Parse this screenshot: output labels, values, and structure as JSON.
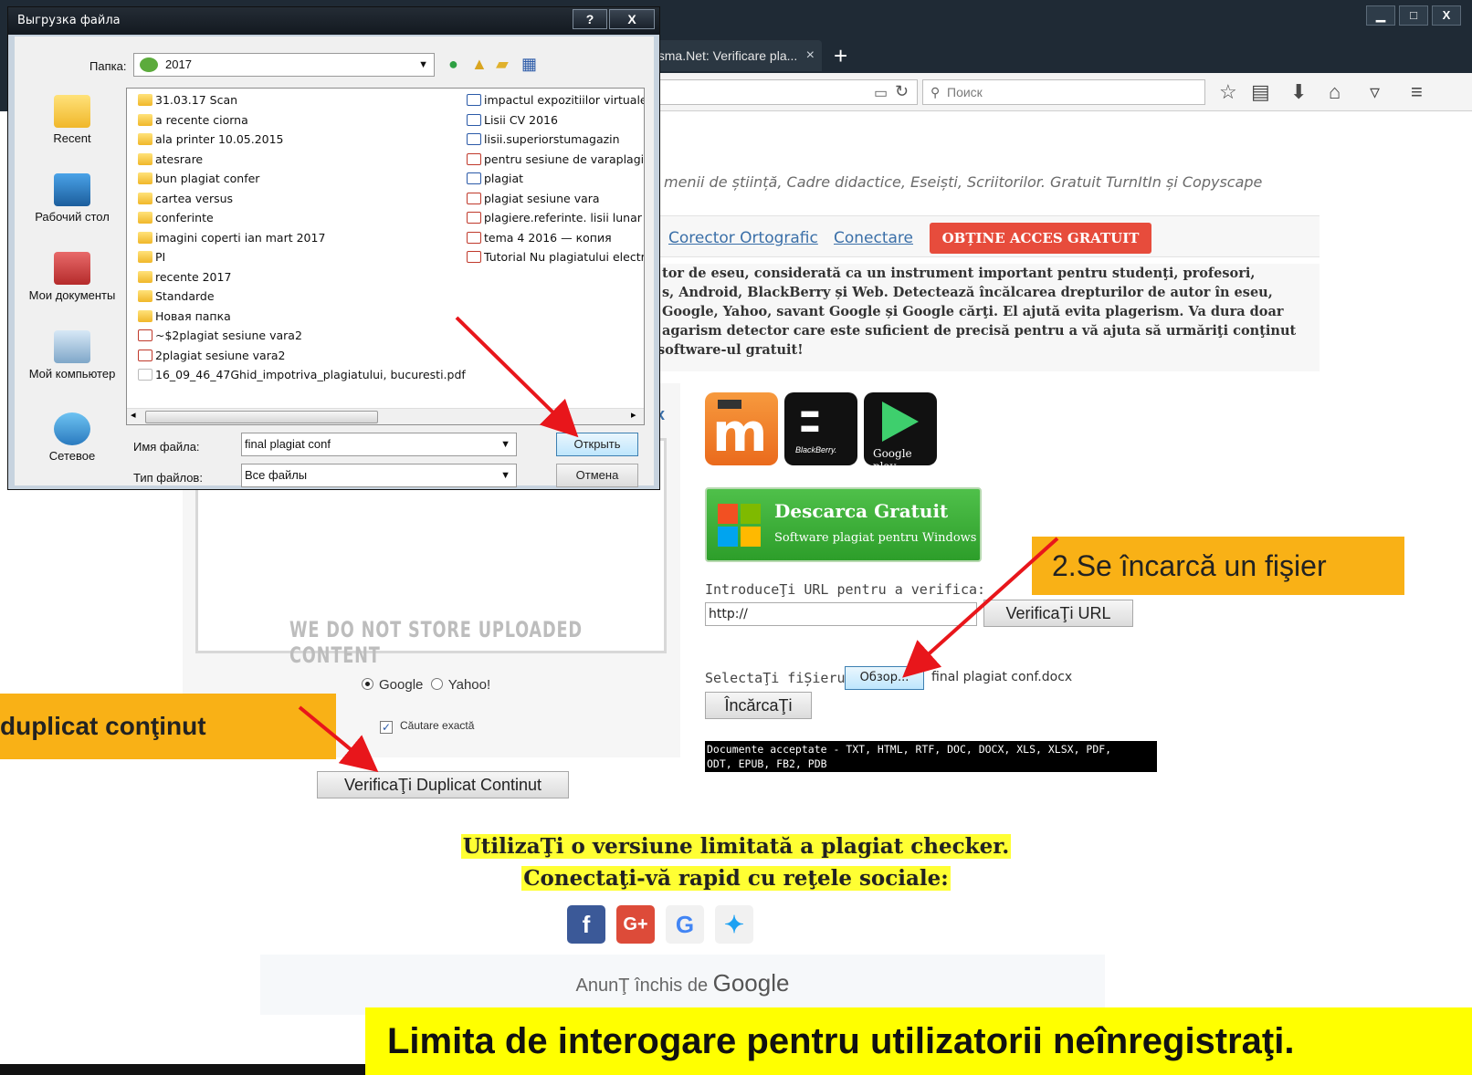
{
  "browser": {
    "tab_title": "risma.Net: Verificare pla...",
    "tab_close": "×",
    "new_tab": "+",
    "search_placeholder": "Поиск"
  },
  "page": {
    "tagline": "menii de știință, Cadre didactice, Eseiști, Scriitorilor. Gratuit TurnItIn și Copyscape",
    "menu": {
      "link1": "Corector Ortografic",
      "link2": "Conectare",
      "cta": "OBȚINE ACCES GRATUIT"
    },
    "description": [
      "tor de eseu, considerată ca un instrument important pentru studenţi, profesori,",
      "s, Android, BlackBerry și Web. Detectează încălcarea drepturilor de autor în eseu,",
      "Google, Yahoo, savant Google și Google cărţi. El ajută evita plagerism. Va dura doar",
      "agarism detector care este suficient de precisă pentru a vă ajuta să urmăriţi conţinut",
      " software-ul gratuit!"
    ],
    "no_store": "WE DO NOT STORE UPLOADED CONTENT",
    "left_x": "x",
    "radio_google": "Google",
    "radio_yahoo": "Yahoo!",
    "exact_search": "Căutare exactă",
    "dup_button": "VerificaŢi Duplicat Continut",
    "apps": {
      "blackberry_caption": "BlackBerry.",
      "gplay_caption": "Google play"
    },
    "download": {
      "title": "Descarca Gratuit",
      "subtitle": "Software plagiat pentru Windows"
    },
    "url_label": "IntroduceŢi URL pentru a verifica:",
    "url_value": "http://",
    "url_button": "VerificaŢi URL",
    "file_label": "SelectaŢi fiȘierul:",
    "browse_button": "Обзор...",
    "file_name": "final plagiat conf.docx",
    "upload_button": "ÎncărcaŢi",
    "accepted_1": "Documente acceptate - TXT, HTML, RTF, DOC, DOCX, XLS, XLSX, PDF,",
    "accepted_2": "ODT, EPUB, FB2, PDB",
    "limited_1": "UtilizaŢi o versiune limitată a plagiat checker.",
    "limited_2": "Conectaţi-vă rapid cu reţele sociale:",
    "ad_prefix": "AnunŢ închis de",
    "ad_google": "Google"
  },
  "annotations": {
    "step2": "2.Se  încarcă un fişier",
    "duplicate": " duplicat conţinut",
    "limit": "Limita de interogare pentru utilizatorii neînregistraţi."
  },
  "dialog": {
    "title": "Выгрузка файла",
    "help": "?",
    "close": "X",
    "folder_label": "Папка:",
    "folder_value": "2017",
    "places": [
      "Recent",
      "Рабочий стол",
      "Мои документы",
      "Мой компьютер",
      "Сетевое"
    ],
    "files_col1": [
      {
        "name": "31.03.17 Scan",
        "type": "folder"
      },
      {
        "name": "a recente ciorna",
        "type": "folder"
      },
      {
        "name": "ala printer 10.05.2015",
        "type": "folder"
      },
      {
        "name": "atesrare",
        "type": "folder"
      },
      {
        "name": "bun plagiat confer",
        "type": "folder"
      },
      {
        "name": "cartea versus",
        "type": "folder"
      },
      {
        "name": "conferinte",
        "type": "folder"
      },
      {
        "name": "imagini coperti ian mart 2017",
        "type": "folder"
      },
      {
        "name": "PI",
        "type": "folder"
      },
      {
        "name": "recente 2017",
        "type": "folder"
      },
      {
        "name": "Standarde",
        "type": "folder"
      },
      {
        "name": "Новая папка",
        "type": "folder"
      },
      {
        "name": "~$2plagiat sesiune vara2",
        "type": "pdf"
      },
      {
        "name": "2plagiat sesiune vara2",
        "type": "pdf"
      },
      {
        "name": "16_09_46_47Ghid_impotriva_plagiatului, bucuresti.pdf",
        "type": "blank"
      }
    ],
    "files_col2": [
      {
        "name": "impactul expozitiilor virtuale.l",
        "type": "word"
      },
      {
        "name": "Lisii CV 2016",
        "type": "word"
      },
      {
        "name": "lisii.superiorstumagazin",
        "type": "word"
      },
      {
        "name": "pentru sesiune de varaplagie",
        "type": "pdf"
      },
      {
        "name": "plagiat",
        "type": "word"
      },
      {
        "name": "plagiat sesiune vara",
        "type": "pdf"
      },
      {
        "name": "plagiere.referinte. lisii lunar",
        "type": "pdf"
      },
      {
        "name": "tema 4  2016 — копия",
        "type": "pdf"
      },
      {
        "name": "Tutorial Nu plagiatului electro",
        "type": "pdf"
      }
    ],
    "filename_label": "Имя файла:",
    "filename_value": "final plagiat conf",
    "filetype_label": "Тип файлов:",
    "filetype_value": "Все файлы",
    "open_button": "Открыть",
    "cancel_button": "Отмена"
  }
}
